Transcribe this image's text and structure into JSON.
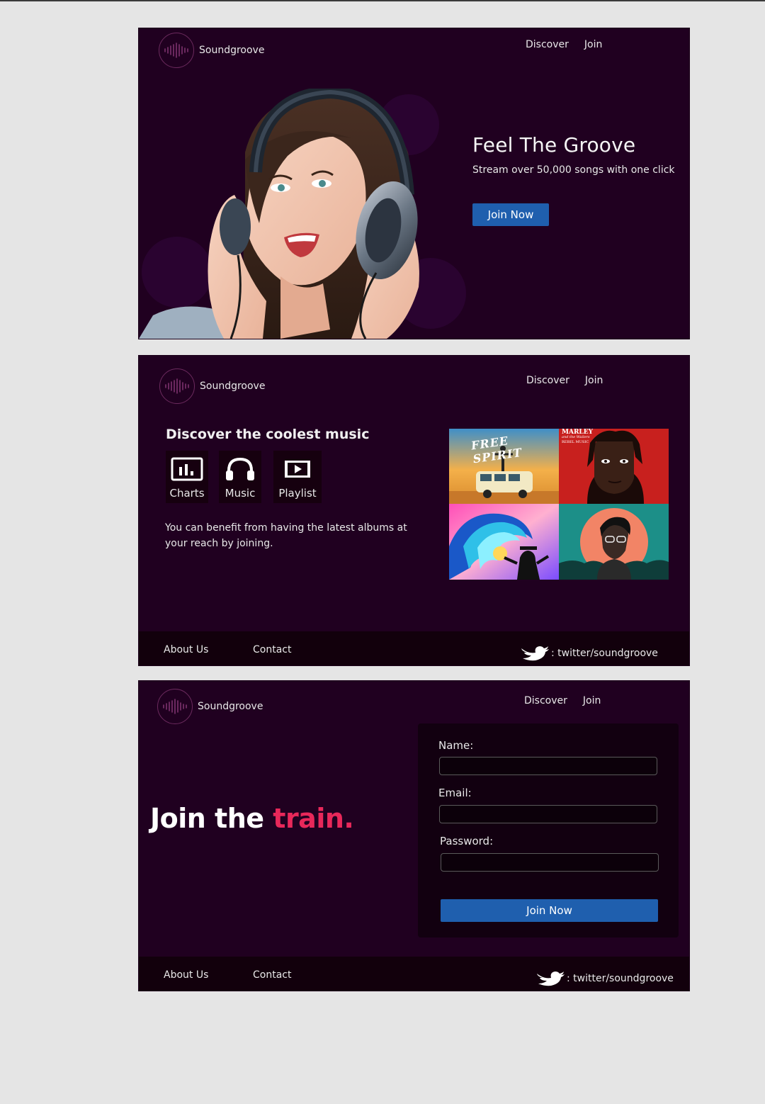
{
  "brand": {
    "name": "Soundgroove"
  },
  "nav": {
    "discover": "Discover",
    "join": "Join"
  },
  "hero": {
    "title": "Feel The Groove",
    "subtitle": "Stream over 50,000 songs with one click",
    "button": "Join Now"
  },
  "discover": {
    "title": "Discover the coolest music",
    "features": [
      {
        "label": "Charts",
        "icon": "chart-icon"
      },
      {
        "label": "Music",
        "icon": "headphones-icon"
      },
      {
        "label": "Playlist",
        "icon": "playlist-icon"
      }
    ],
    "body": "You can benefit from having the latest albums at your reach by joining.",
    "albums": [
      {
        "title_text": "FREE SPIRIT"
      },
      {
        "title_text": "MARLEY",
        "subtitle_text": "and the Wailers",
        "extra_text": "REBEL MUSIC"
      },
      {
        "title_text": ""
      },
      {
        "title_text": ""
      }
    ]
  },
  "footer": {
    "about": "About Us",
    "contact": "Contact",
    "twitter": ": twitter/soundgroove"
  },
  "join": {
    "headline_a": "Join the ",
    "headline_b": "train.",
    "name_label": "Name:",
    "name_value": "",
    "email_label": "Email:",
    "email_value": "",
    "password_label": "Password:",
    "password_value": "",
    "button": "Join Now"
  },
  "colors": {
    "background": "#200020",
    "footer": "#12000c",
    "accent_blue": "#1f5fae",
    "accent_pink": "#e8285a"
  }
}
